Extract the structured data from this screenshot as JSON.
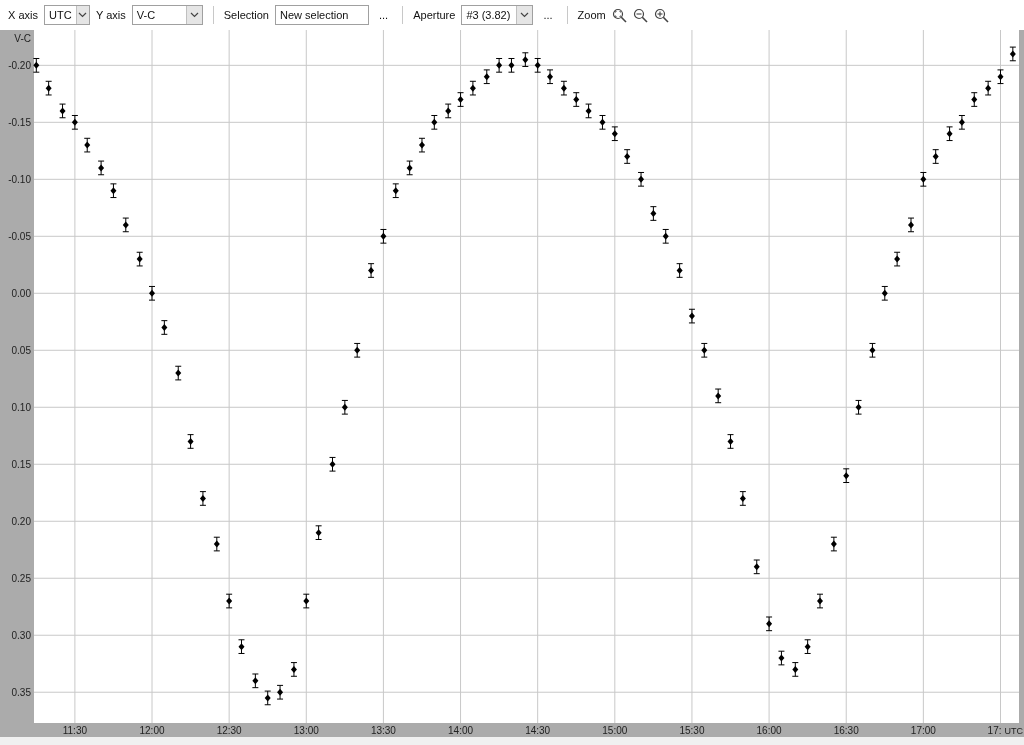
{
  "toolbar": {
    "x_axis": {
      "label": "X axis",
      "value": "UTC"
    },
    "y_axis": {
      "label": "Y axis",
      "value": "V-C"
    },
    "selection": {
      "label": "Selection",
      "value": "New selection",
      "more": "..."
    },
    "aperture": {
      "label": "Aperture",
      "value": "#3 (3.82)",
      "more": "..."
    },
    "zoom": {
      "label": "Zoom"
    }
  },
  "chart_data": {
    "type": "scatter",
    "xlabel": "UTC",
    "ylabel": "V-C",
    "grid": true,
    "xlim": [
      11.235,
      17.62
    ],
    "ylim": [
      0.377,
      -0.231
    ],
    "xticks": [
      {
        "value": 11.5,
        "label": "11:30"
      },
      {
        "value": 12,
        "label": "12:00"
      },
      {
        "value": 12.5,
        "label": "12:30"
      },
      {
        "value": 13,
        "label": "13:00"
      },
      {
        "value": 13.5,
        "label": "13:30"
      },
      {
        "value": 14,
        "label": "14:00"
      },
      {
        "value": 14.5,
        "label": "14:30"
      },
      {
        "value": 15,
        "label": "15:00"
      },
      {
        "value": 15.5,
        "label": "15:30"
      },
      {
        "value": 16,
        "label": "16:00"
      },
      {
        "value": 16.5,
        "label": "16:30"
      },
      {
        "value": 17,
        "label": "17:00"
      },
      {
        "value": 17.5,
        "label": "17:"
      }
    ],
    "yticks": [
      {
        "value": -0.2,
        "label": "-0.20"
      },
      {
        "value": -0.15,
        "label": "-0.15"
      },
      {
        "value": -0.1,
        "label": "-0.10"
      },
      {
        "value": -0.05,
        "label": "-0.05"
      },
      {
        "value": 0,
        "label": "0.00"
      },
      {
        "value": 0.05,
        "label": "0.05"
      },
      {
        "value": 0.1,
        "label": "0.10"
      },
      {
        "value": 0.15,
        "label": "0.15"
      },
      {
        "value": 0.2,
        "label": "0.20"
      },
      {
        "value": 0.25,
        "label": "0.25"
      },
      {
        "value": 0.3,
        "label": "0.30"
      },
      {
        "value": 0.35,
        "label": "0.35"
      }
    ],
    "x": [
      11.25,
      11.33,
      11.42,
      11.5,
      11.58,
      11.67,
      11.75,
      11.83,
      11.92,
      12.0,
      12.08,
      12.17,
      12.25,
      12.33,
      12.42,
      12.5,
      12.58,
      12.67,
      12.75,
      12.83,
      12.92,
      13.0,
      13.08,
      13.17,
      13.25,
      13.33,
      13.42,
      13.5,
      13.58,
      13.67,
      13.75,
      13.83,
      13.92,
      14.0,
      14.08,
      14.17,
      14.25,
      14.33,
      14.42,
      14.5,
      14.58,
      14.67,
      14.75,
      14.83,
      14.92,
      15.0,
      15.08,
      15.17,
      15.25,
      15.33,
      15.42,
      15.5,
      15.58,
      15.67,
      15.75,
      15.83,
      15.92,
      16.0,
      16.08,
      16.17,
      16.25,
      16.33,
      16.42,
      16.5,
      16.58,
      16.67,
      16.75,
      16.83,
      16.92,
      17.0,
      17.08,
      17.17,
      17.25,
      17.33,
      17.42,
      17.5,
      17.58
    ],
    "series": [
      {
        "color": "#000000",
        "values": [
          -0.2,
          -0.18,
          -0.16,
          -0.15,
          -0.13,
          -0.11,
          -0.09,
          -0.06,
          -0.03,
          0.0,
          0.03,
          0.07,
          0.13,
          0.18,
          0.22,
          0.27,
          0.31,
          0.34,
          0.355,
          0.35,
          0.33,
          0.27,
          0.21,
          0.15,
          0.1,
          0.05,
          -0.02,
          -0.05,
          -0.09,
          -0.11,
          -0.13,
          -0.15,
          -0.16,
          -0.17,
          -0.18,
          -0.19,
          -0.2,
          -0.2,
          -0.205,
          -0.2,
          -0.19,
          -0.18,
          -0.17,
          -0.16,
          -0.15,
          -0.14,
          -0.12,
          -0.1,
          -0.07,
          -0.05,
          -0.02,
          0.02,
          0.05,
          0.09,
          0.13,
          0.18,
          0.24,
          0.29,
          0.32,
          0.33,
          0.31,
          0.27,
          0.22,
          0.16,
          0.1,
          0.05,
          0.0,
          -0.03,
          -0.06,
          -0.1,
          -0.12,
          -0.14,
          -0.15,
          -0.17,
          -0.18,
          -0.19,
          -0.21
        ],
        "errors": [
          0.006,
          0.006,
          0.006,
          0.006,
          0.006,
          0.006,
          0.006,
          0.006,
          0.006,
          0.006,
          0.006,
          0.006,
          0.006,
          0.006,
          0.006,
          0.006,
          0.006,
          0.006,
          0.006,
          0.006,
          0.006,
          0.006,
          0.006,
          0.006,
          0.006,
          0.006,
          0.006,
          0.006,
          0.006,
          0.006,
          0.006,
          0.006,
          0.006,
          0.006,
          0.006,
          0.006,
          0.006,
          0.006,
          0.006,
          0.006,
          0.006,
          0.006,
          0.006,
          0.006,
          0.006,
          0.006,
          0.006,
          0.006,
          0.006,
          0.006,
          0.006,
          0.006,
          0.006,
          0.006,
          0.006,
          0.006,
          0.006,
          0.006,
          0.006,
          0.006,
          0.006,
          0.006,
          0.006,
          0.006,
          0.006,
          0.006,
          0.006,
          0.006,
          0.006,
          0.006,
          0.006,
          0.006,
          0.006,
          0.006,
          0.006,
          0.006,
          0.006
        ]
      }
    ]
  }
}
